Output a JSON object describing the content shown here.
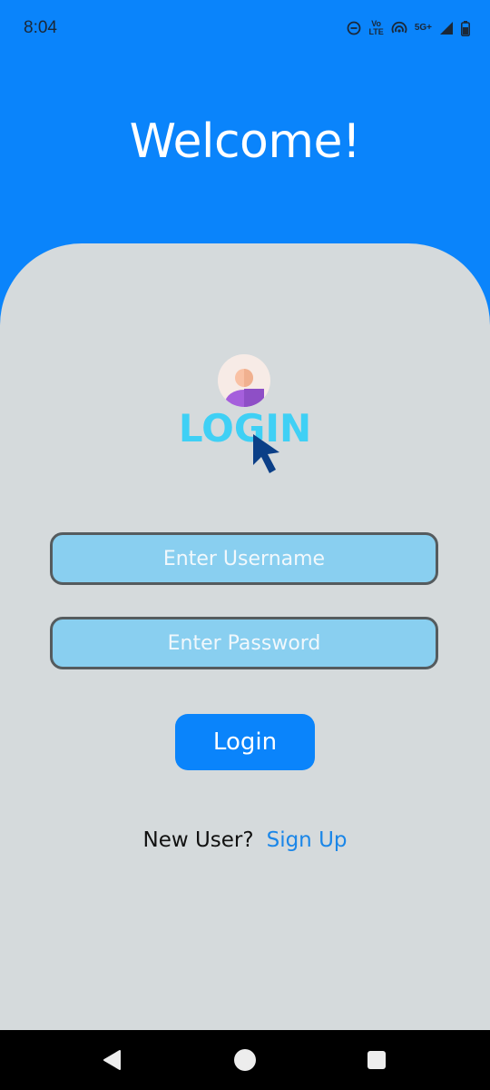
{
  "status_bar": {
    "time": "8:04",
    "volte_top": "Vo",
    "volte_bottom": "LTE",
    "network": "5G+"
  },
  "header": {
    "title": "Welcome!"
  },
  "logo": {
    "text": "LOGIN"
  },
  "form": {
    "username_placeholder": "Enter Username",
    "username_value": "",
    "password_placeholder": "Enter Password",
    "password_value": "",
    "login_label": "Login"
  },
  "signup": {
    "prompt": "New User?",
    "link_label": "Sign Up"
  },
  "colors": {
    "primary": "#0a84fb",
    "card_background": "#d5dadc",
    "input_background": "#89cff0",
    "link": "#1a86e8"
  },
  "icons": {
    "status": [
      "do-not-disturb-icon",
      "volte-icon",
      "hotspot-icon",
      "signal-icon",
      "battery-icon"
    ],
    "navigation": [
      "back-icon",
      "home-icon",
      "recent-apps-icon"
    ]
  }
}
